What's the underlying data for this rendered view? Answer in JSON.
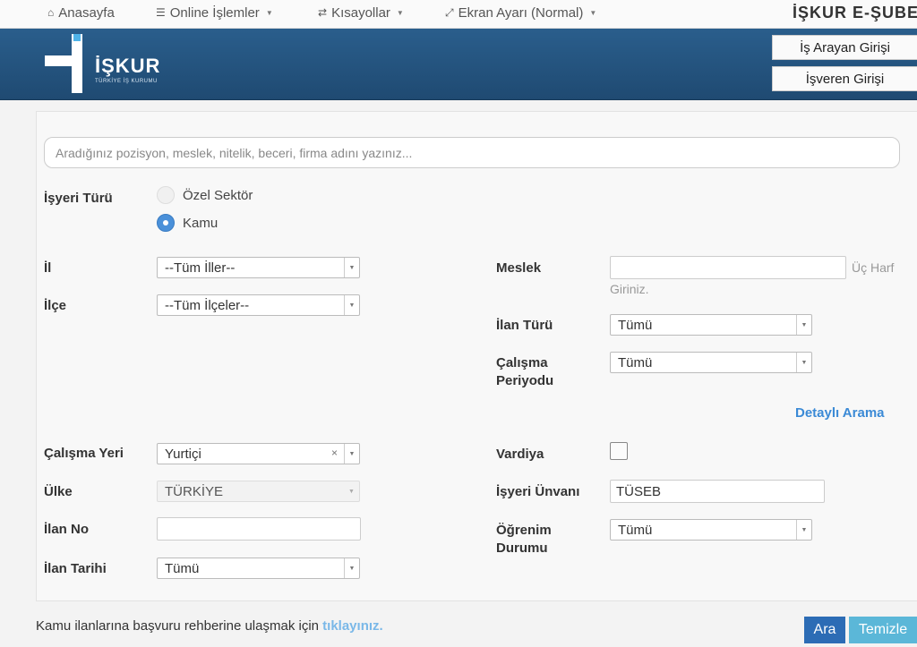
{
  "nav": {
    "home": "Anasayfa",
    "online": "Online İşlemler",
    "shortcuts": "Kısayollar",
    "screen": "Ekran Ayarı (Normal)",
    "brand": "İŞKUR E-ŞUBE"
  },
  "banner": {
    "logo_text": "İŞKUR",
    "logo_sub": "TÜRKİYE İŞ KURUMU",
    "job_seeker_login": "İş Arayan Girişi",
    "employer_login": "İşveren Girişi"
  },
  "search": {
    "placeholder": "Aradığınız pozisyon, meslek, nitelik, beceri, firma adını yazınız..."
  },
  "form": {
    "workplace_type_label": "İşyeri Türü",
    "workplace_type_options": [
      "Özel Sektör",
      "Kamu"
    ],
    "workplace_type_selected": "Kamu",
    "province_label": "İl",
    "province_value": "--Tüm İller--",
    "district_label": "İlçe",
    "district_value": "--Tüm İlçeler--",
    "occupation_label": "Meslek",
    "occupation_value": "",
    "occupation_hint_1": "Üç Harf",
    "occupation_hint_2": "Giriniz.",
    "listing_type_label": "İlan Türü",
    "listing_type_value": "Tümü",
    "work_period_label_1": "Çalışma",
    "work_period_label_2": "Periyodu",
    "work_period_value": "Tümü",
    "advanced_search": "Detaylı Arama",
    "work_place_label": "Çalışma Yeri",
    "work_place_value": "Yurtiçi",
    "country_label": "Ülke",
    "country_value": "TÜRKİYE",
    "listing_no_label": "İlan No",
    "listing_no_value": "",
    "listing_date_label": "İlan Tarihi",
    "listing_date_value": "Tümü",
    "shift_label": "Vardiya",
    "shift_checked": false,
    "employer_title_label": "İşyeri Ünvanı",
    "employer_title_value": "TÜSEB",
    "education_label_1": "Öğrenim",
    "education_label_2": "Durumu",
    "education_value": "Tümü"
  },
  "footer": {
    "text": "Kamu ilanlarına başvuru rehberine ulaşmak için",
    "link": "tıklayınız.",
    "search_button": "Ara",
    "clear_button": "Temizle"
  }
}
